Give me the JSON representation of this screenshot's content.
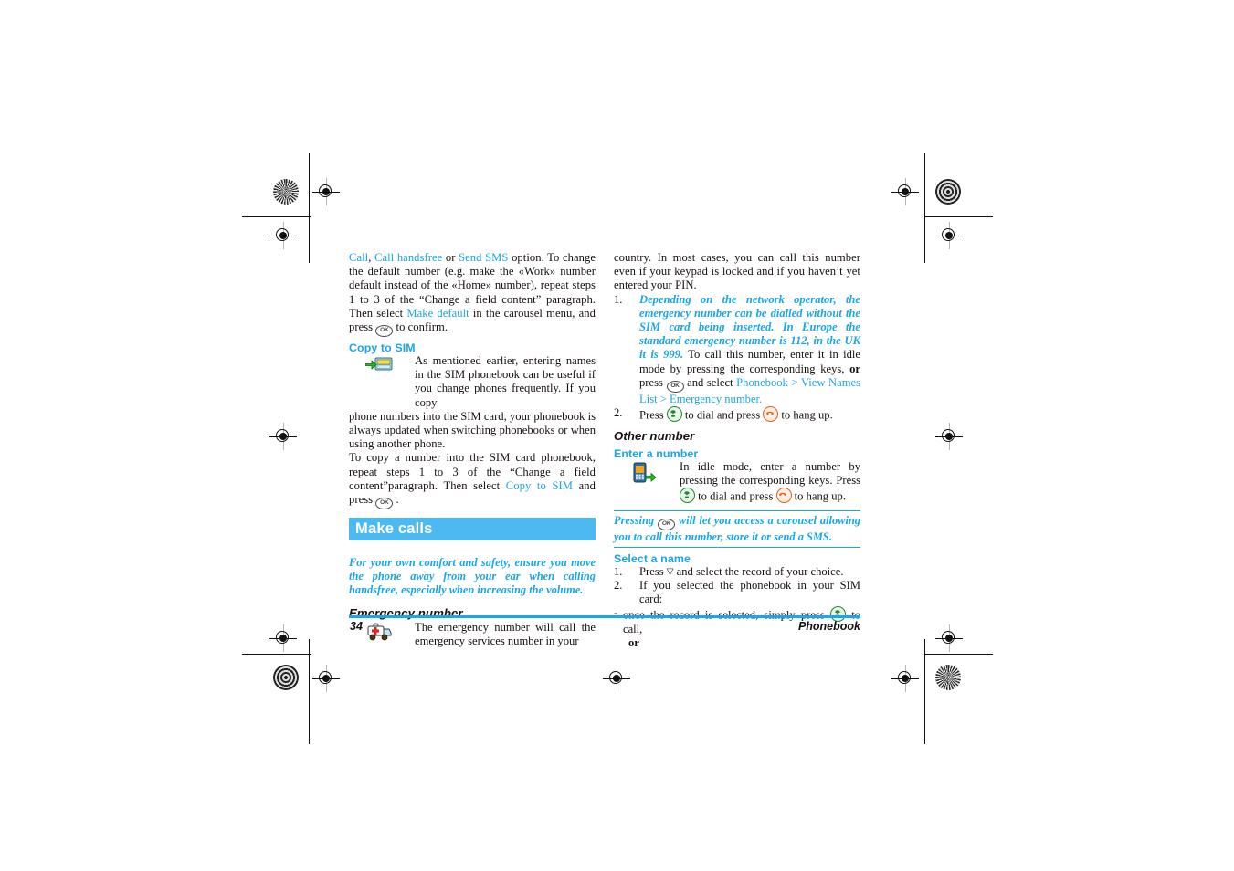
{
  "document": {
    "footer": {
      "page_number": "34",
      "section": "Phonebook"
    },
    "colors": {
      "accent_blue": "#1aa6e8",
      "header_bar": "#4cbaf0",
      "body_text": "#17100e"
    }
  },
  "left_column": {
    "para_1_part_a": "Call",
    "para_1_sep_1": ", ",
    "para_1_part_b": "Call handsfree",
    "para_1_sep_2": " or ",
    "para_1_part_c": "Send SMS",
    "para_1_rest": " option. To change the default number (e.g. make the «Work» number default instead of the «Home» number), repeat steps 1 to 3 of the “Change a field content” paragraph. Then select ",
    "para_1_link_make_default": "Make default",
    "para_1_tail": " in the carousel menu, and press",
    "para_1_tail_2": "to confirm.",
    "heading_copy_to_sim": "Copy to SIM",
    "copy_icon_name": "copy-to-sim-icon",
    "para_2_indented": "As mentioned earlier, entering names in the SIM phonebook can be useful if you change phones frequently. If you copy",
    "para_2_continued": "phone numbers into the SIM card, your phonebook is always updated when switching phonebooks or when using another phone.",
    "para_3_pre": "To copy a number into the SIM card phonebook, repeat steps 1 to 3 of the “Change a field content”paragraph. Then select ",
    "para_3_link": "Copy to SIM",
    "para_3_post": " and press",
    "para_3_tail": ".",
    "section_title": "Make calls",
    "note": "For your own comfort and safety, ensure you move the phone away from your ear when calling handsfree, especially when increasing the volume.",
    "heading_emergency": "Emergency number",
    "emergency_icon_name": "ambulance-icon",
    "emergency_text": "The emergency number will call the emergency services number in your"
  },
  "right_column": {
    "para_continued": "country. In most cases, you can call this number even if your keypad is locked and if you haven’t yet entered your PIN.",
    "item_1_number": "1.",
    "item_1_italic": "Depending on the network operator, the emergency number can be dialled without the SIM card being inserted. In Europe the standard emergency number is 112, in the UK it is 999.",
    "item_1_rest_a": " To call this number, enter it in idle mode by pressing the corresponding keys, ",
    "item_1_bold_or": "or",
    "item_1_rest_b": " press",
    "item_1_rest_c": "and select",
    "item_1_link_1": "Phonebook",
    "item_1_gt_1": " > ",
    "item_1_link_2": "View Names List",
    "item_1_gt_2": " > ",
    "item_1_link_3": "Emergency number",
    "item_1_period": ".",
    "item_2_number": "2.",
    "item_2_text_a": "Press",
    "item_2_text_b": "to dial and press",
    "item_2_text_c": "to hang up.",
    "heading_other_number": "Other number",
    "heading_enter_a_number": "Enter a number",
    "enter_number_icon_name": "phone-dial-icon",
    "enter_number_text_a": "In idle mode, enter a number by pressing the corresponding keys. Press",
    "enter_number_text_b": "to dial and press",
    "enter_number_text_c": "to hang up.",
    "note_a": "Pressing",
    "note_b": "will let you access a carousel allowing you to call this number, store it or send a SMS.",
    "heading_select_a_name": "Select a name",
    "select_1_number": "1.",
    "select_1_text_a": "Press",
    "select_1_text_b": "and select the record of your choice.",
    "select_2_number": "2.",
    "select_2_text": "If you selected the phonebook in your SIM card:",
    "select_dash": "-",
    "select_dash_text_a": "once the record is selected, simply press",
    "select_dash_text_b": "to call,",
    "select_or": "or"
  },
  "glyphs": {
    "ok_key": "OK",
    "down_arrow": "▽"
  }
}
